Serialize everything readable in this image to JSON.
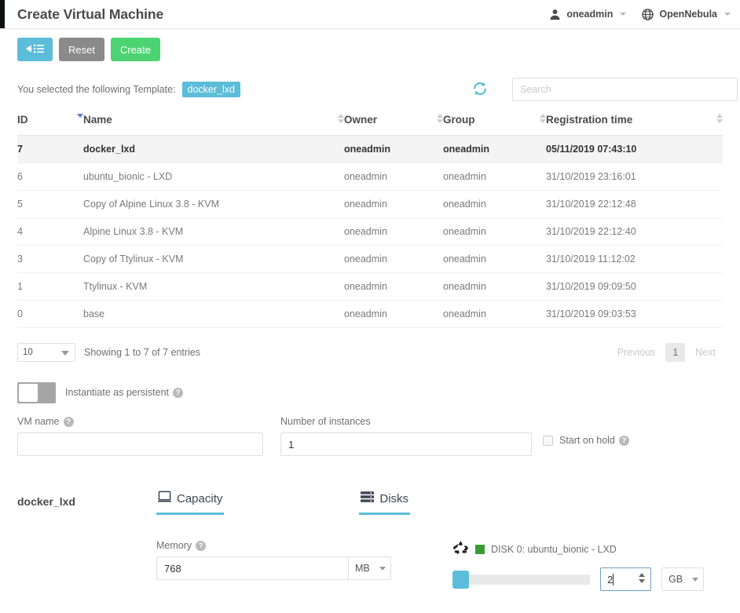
{
  "header": {
    "title": "Create Virtual Machine",
    "user": {
      "label": "oneadmin",
      "icon": "user-icon"
    },
    "zone": {
      "label": "OpenNebula",
      "icon": "globe-icon"
    }
  },
  "toolbar": {
    "back_label": "",
    "reset_label": "Reset",
    "create_label": "Create"
  },
  "selection": {
    "prefix": "You selected the following Template:",
    "template": "docker_lxd"
  },
  "search": {
    "placeholder": "Search",
    "value": "",
    "refresh_icon": "refresh-icon"
  },
  "table": {
    "columns": [
      "ID",
      "Name",
      "Owner",
      "Group",
      "Registration time"
    ],
    "sort_column": "ID",
    "sort_direction": "desc",
    "rows": [
      {
        "id": "7",
        "name": "docker_lxd",
        "owner": "oneadmin",
        "group": "oneadmin",
        "time": "05/11/2019 07:43:10",
        "selected": true
      },
      {
        "id": "6",
        "name": "ubuntu_bionic - LXD",
        "owner": "oneadmin",
        "group": "oneadmin",
        "time": "31/10/2019 23:16:01",
        "selected": false
      },
      {
        "id": "5",
        "name": "Copy of Alpine Linux 3.8 - KVM",
        "owner": "oneadmin",
        "group": "oneadmin",
        "time": "31/10/2019 22:12:48",
        "selected": false
      },
      {
        "id": "4",
        "name": "Alpine Linux 3.8 - KVM",
        "owner": "oneadmin",
        "group": "oneadmin",
        "time": "31/10/2019 22:12:40",
        "selected": false
      },
      {
        "id": "3",
        "name": "Copy of Ttylinux - KVM",
        "owner": "oneadmin",
        "group": "oneadmin",
        "time": "31/10/2019 11:12:02",
        "selected": false
      },
      {
        "id": "1",
        "name": "Ttylinux - KVM",
        "owner": "oneadmin",
        "group": "oneadmin",
        "time": "31/10/2019 09:09:50",
        "selected": false
      },
      {
        "id": "0",
        "name": "base",
        "owner": "oneadmin",
        "group": "oneadmin",
        "time": "31/10/2019 09:03:53",
        "selected": false
      }
    ]
  },
  "pagination": {
    "page_length": "10",
    "showing": "Showing 1 to 7 of 7 entries",
    "previous_label": "Previous",
    "current_page": "1",
    "next_label": "Next"
  },
  "options": {
    "persistent": {
      "label": "Instantiate as persistent",
      "enabled": false,
      "help": "?"
    },
    "vm_name": {
      "label": "VM name",
      "value": "",
      "help": "?"
    },
    "instances": {
      "label": "Number of instances",
      "value": "1"
    },
    "start_on_hold": {
      "label": "Start on hold",
      "checked": false,
      "help": "?"
    }
  },
  "detail": {
    "template_name": "docker_lxd",
    "tabs": [
      {
        "label": "Capacity",
        "icon": "monitor-icon",
        "active": true
      },
      {
        "label": "Disks",
        "icon": "server-stack-icon",
        "active": true
      }
    ],
    "capacity": {
      "memory_label": "Memory",
      "memory_value": "768",
      "memory_unit": "MB",
      "help": "?"
    },
    "disks": {
      "icon": "recycle-icon",
      "status_color": "#3a9b35",
      "title": "DISK 0: ubuntu_bionic - LXD",
      "size_value": "2",
      "size_unit": "GB",
      "slider_percent": 0
    }
  },
  "colors": {
    "accent": "#5bbdd9",
    "create": "#4cd473",
    "reset": "#8a8a8a",
    "disk_status": "#3a9b35"
  }
}
